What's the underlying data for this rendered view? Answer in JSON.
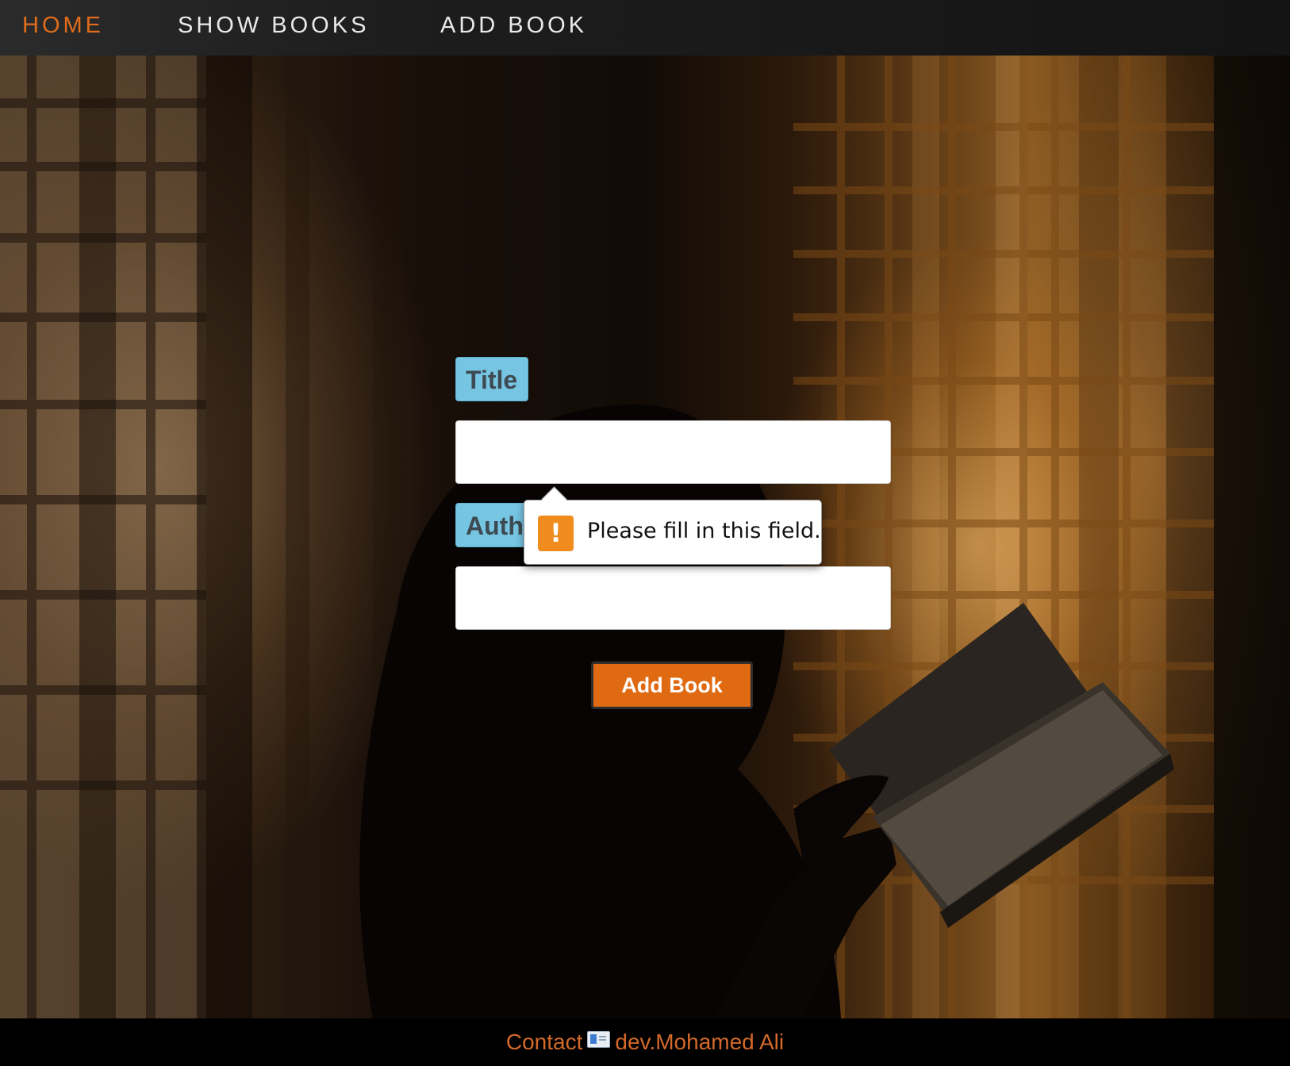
{
  "nav": {
    "links": [
      {
        "label": "HOME",
        "active": true
      },
      {
        "label": "SHOW BOOKS",
        "active": false
      },
      {
        "label": "ADD BOOK",
        "active": false
      }
    ]
  },
  "form": {
    "title_label": "Title",
    "author_label": "Author",
    "title_value": "",
    "author_value": "",
    "submit_label": "Add Book"
  },
  "validation": {
    "icon": "!",
    "message": "Please fill in this field."
  },
  "footer": {
    "contact_label": "Contact",
    "author_link": "dev.Mohamed Ali"
  },
  "colors": {
    "accent": "#e06a12",
    "label_bg": "#76c5e2",
    "warning": "#f08c1e"
  },
  "icons": {
    "warning": "exclamation-icon",
    "mail": "envelope-icon"
  }
}
